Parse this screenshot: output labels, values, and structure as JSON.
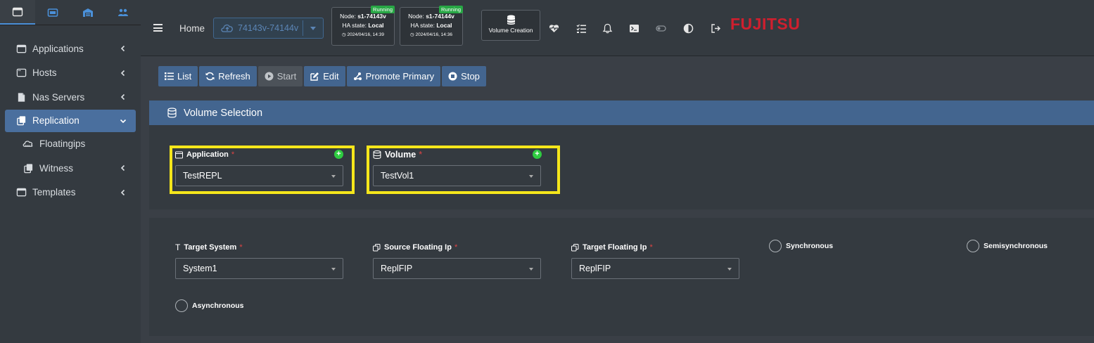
{
  "sidebar": {
    "tabs": [
      {
        "icon": "window-icon"
      },
      {
        "icon": "server-card-icon"
      },
      {
        "icon": "warehouse-icon"
      },
      {
        "icon": "users-icon"
      }
    ],
    "items": [
      {
        "label": "Applications",
        "icon": "window-icon"
      },
      {
        "label": "Hosts",
        "icon": "host-icon"
      },
      {
        "label": "Nas Servers",
        "icon": "file-icon"
      },
      {
        "label": "Replication",
        "icon": "copy-icon"
      },
      {
        "label": "Floatingips",
        "icon": "cloud-icon"
      },
      {
        "label": "Witness",
        "icon": "copy-icon"
      },
      {
        "label": "Templates",
        "icon": "window-icon"
      }
    ]
  },
  "topbar": {
    "home": "Home",
    "cluster": "74143v-74144v",
    "nodes": [
      {
        "badge": "Running",
        "node_prefix": "Node: ",
        "node": "s1-74143v",
        "ha_prefix": "HA state: ",
        "ha": "Local",
        "time": "2024/04/16, 14:39"
      },
      {
        "badge": "Running",
        "node_prefix": "Node: ",
        "node": "s1-74144v",
        "ha_prefix": "HA state: ",
        "ha": "Local",
        "time": "2024/04/16, 14:36"
      }
    ],
    "volume_creation": "Volume Creation",
    "brand": "FUJITSU"
  },
  "toolbar": {
    "list": "List",
    "refresh": "Refresh",
    "start": "Start",
    "edit": "Edit",
    "promote": "Promote Primary",
    "stop": "Stop"
  },
  "volume_panel": {
    "title": "Volume Selection",
    "application_label": "Application",
    "application_value": "TestREPL",
    "volume_label": "Volume",
    "volume_value": "TestVol1",
    "required_mark": "*",
    "plus": "+"
  },
  "replication_panel": {
    "target_system_label": "Target System",
    "target_system_value": "System1",
    "source_fip_label": "Source Floating Ip",
    "source_fip_value": "ReplFIP",
    "target_fip_label": "Target Floating Ip",
    "target_fip_value": "ReplFIP",
    "modes": [
      "Synchronous",
      "Semisynchronous",
      "Asynchronous"
    ]
  },
  "colors": {
    "accent": "#43658f",
    "highlight": "#f5e61b",
    "brand": "#cf1f2e",
    "running": "#28a745"
  }
}
